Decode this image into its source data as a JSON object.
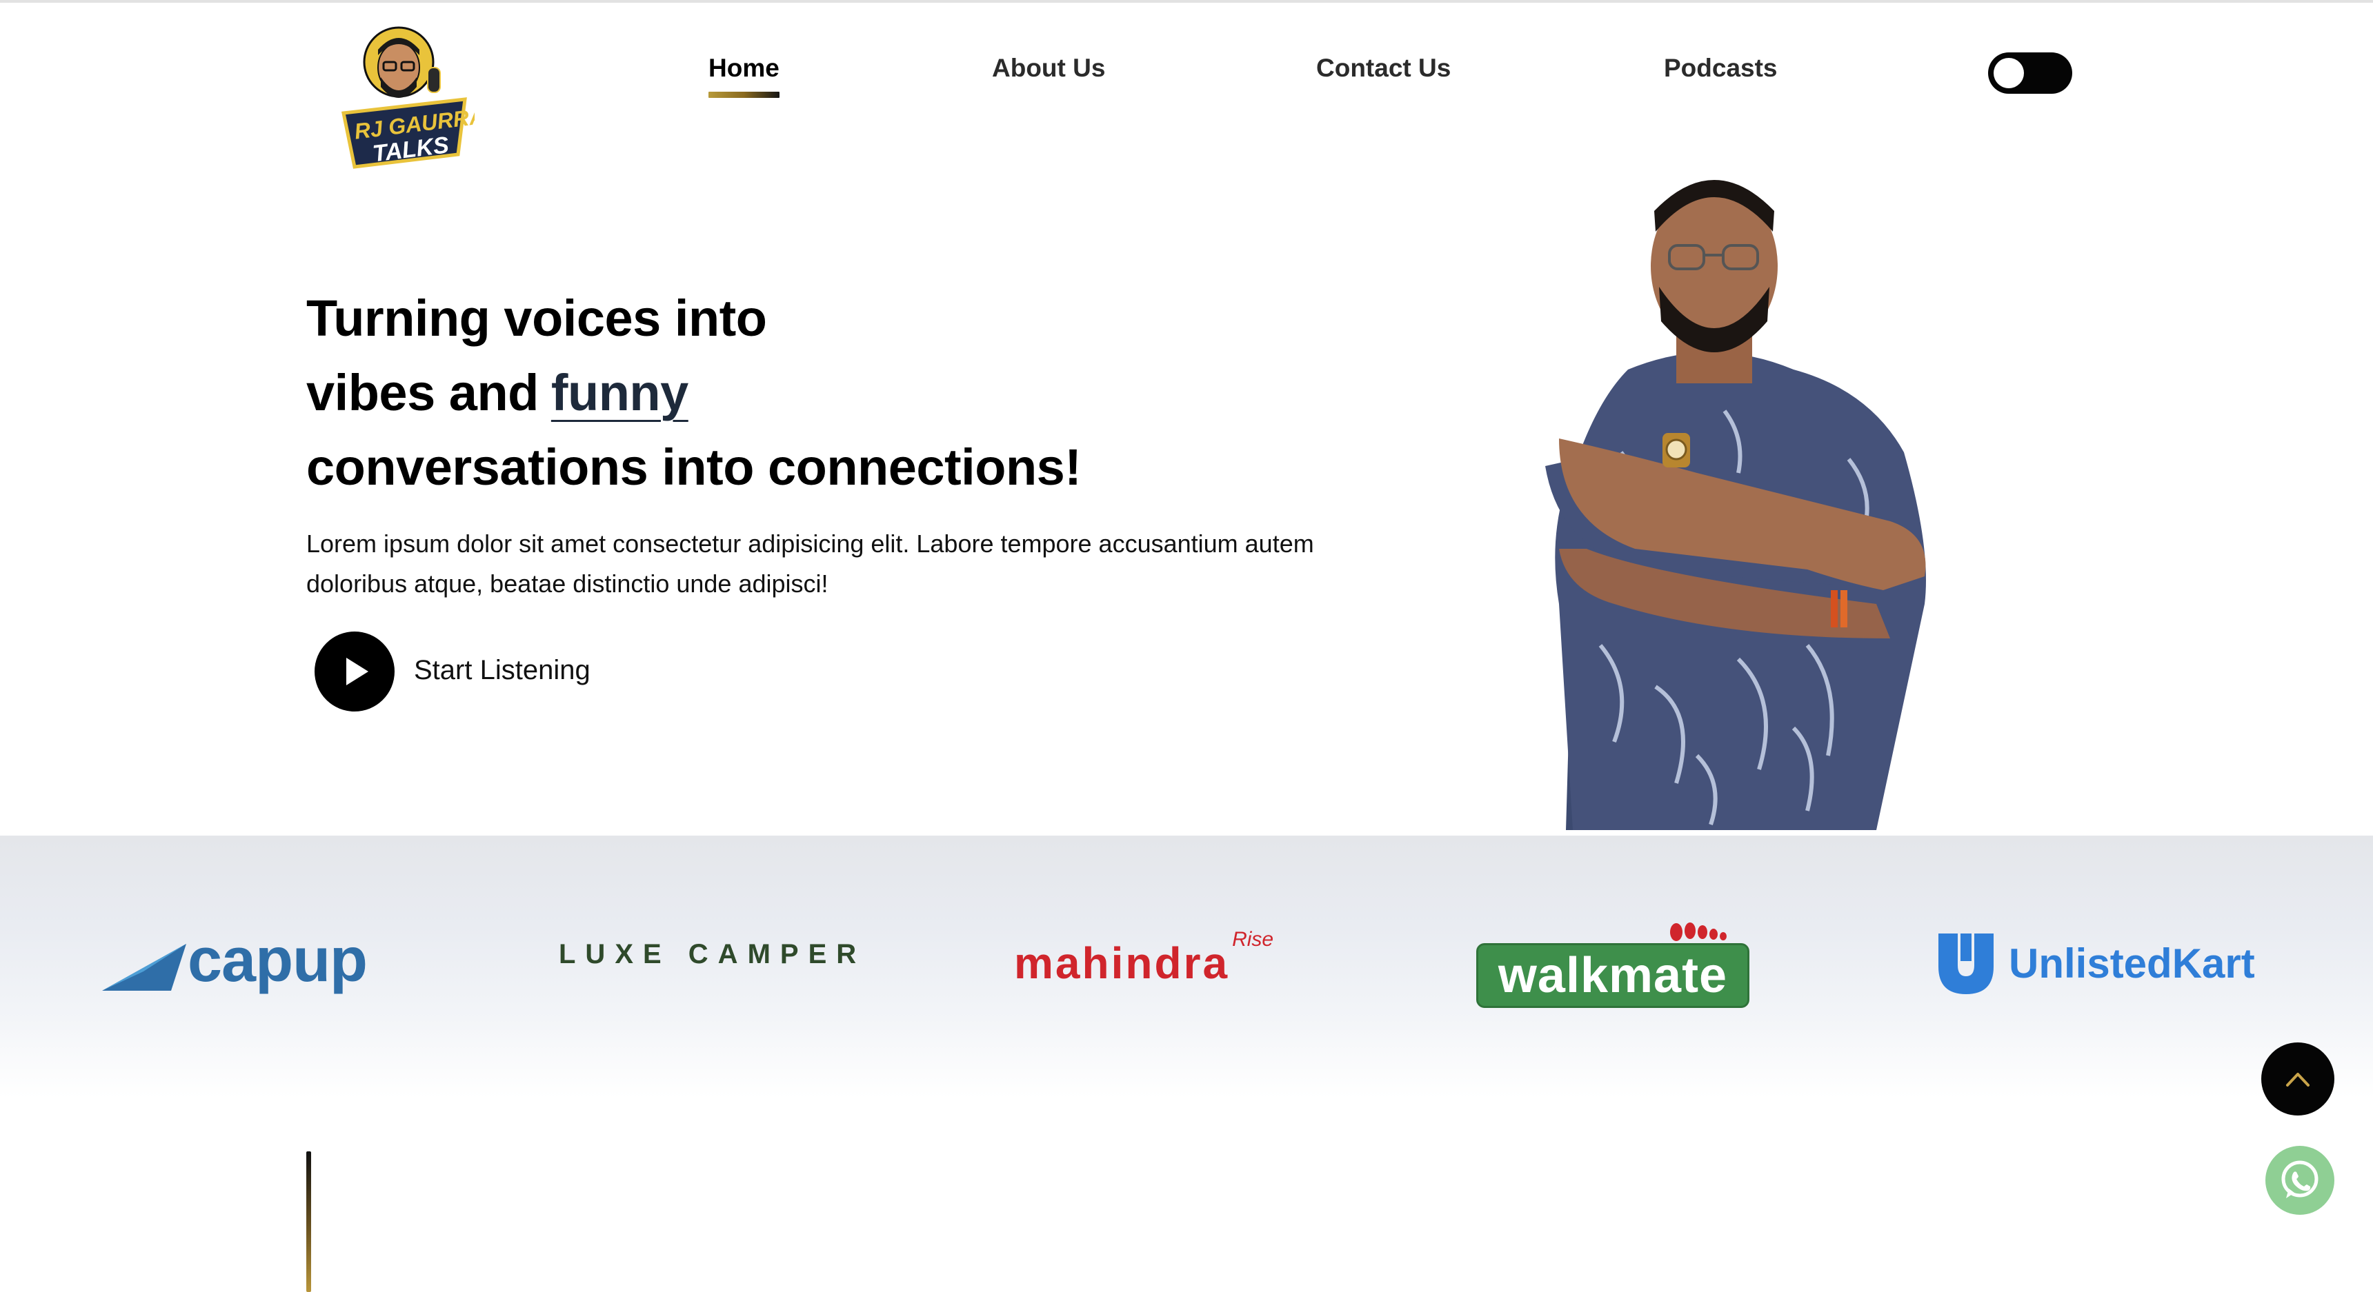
{
  "logo": {
    "line1": "RJ GAURRAV",
    "line2": "TALKS"
  },
  "nav": {
    "items": [
      {
        "label": "Home",
        "active": true
      },
      {
        "label": "About Us",
        "active": false
      },
      {
        "label": "Contact Us",
        "active": false
      },
      {
        "label": "Podcasts",
        "active": false
      }
    ],
    "theme_toggle_icon": "toggle-switch-icon"
  },
  "hero": {
    "headline_line1": "Turning voices into",
    "headline_line2_pre": "vibes and",
    "headline_highlight": "funny",
    "headline_line3": "conversations into connections!",
    "body": "Lorem ipsum dolor sit amet consectetur adipisicing elit. Labore tempore accusantium autem doloribus atque, beatae distinctio unde adipisci!",
    "cta_label": "Start Listening",
    "cta_icon": "play-icon"
  },
  "brands": [
    {
      "name": "capup"
    },
    {
      "name": "LUXE CAMPER"
    },
    {
      "name": "mahindra",
      "tag": "Rise"
    },
    {
      "name": "walkmate"
    },
    {
      "name": "UnlistedKart"
    }
  ],
  "floating": {
    "scroll_top_icon": "chevron-up-icon",
    "whatsapp_icon": "whatsapp-icon"
  },
  "colors": {
    "accent_gold": "#b79a3a",
    "highlight_navy": "#1e2a3b",
    "whatsapp_green": "#8fcf94"
  }
}
